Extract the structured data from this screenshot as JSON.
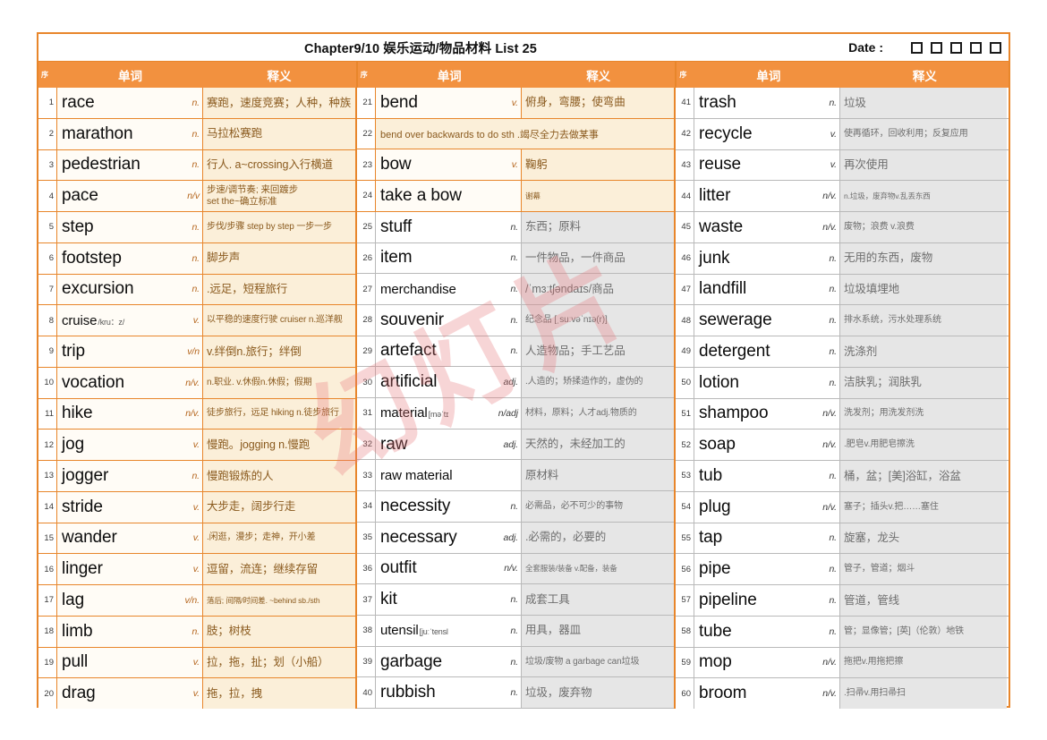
{
  "header": {
    "title": "Chapter9/10 娱乐运动/物品材料 List 25",
    "date_label": "Date :",
    "date_box_count": 5
  },
  "columns": {
    "index": "序",
    "word": "单词",
    "definition": "释义"
  },
  "colors": {
    "header_orange": "#F2913F",
    "border_orange": "#E8862B",
    "cream_def_bg": "#FBEFD9",
    "cream_def_text": "#8A5A1E",
    "gray_def_bg": "#E6E6E6",
    "gray_def_text": "#6E6E6E",
    "gray_border": "#B9B9B9",
    "watermark": "#E8767A"
  },
  "watermark": "幻灯片",
  "blocks": [
    {
      "theme": "orange",
      "rows": [
        {
          "n": "1",
          "word": "race",
          "pos": "n.",
          "def": "赛跑，速度竞赛；人种，种族"
        },
        {
          "n": "2",
          "word": "marathon",
          "pos": "n.",
          "def": "马拉松赛跑"
        },
        {
          "n": "3",
          "word": "pedestrian",
          "pos": "n.",
          "def": "行人. a~crossing入行横道"
        },
        {
          "n": "4",
          "word": "pace",
          "pos": "n/v",
          "def": "步速/调节奏; 来回踱步\nset the~确立标准",
          "def_style": "two"
        },
        {
          "n": "5",
          "word": "step",
          "pos": "n.",
          "def": "步伐/步骤 step by step 一步一步",
          "def_style": "small"
        },
        {
          "n": "6",
          "word": "footstep",
          "pos": "n.",
          "def": "脚步声"
        },
        {
          "n": "7",
          "word": "excursion",
          "pos": "n.",
          "def": ".远足，短程旅行"
        },
        {
          "n": "8",
          "word": "cruise",
          "phon": "/kru：z/",
          "pos": "v.",
          "def": "以平稳的速度行驶 cruiser n.巡洋舰",
          "def_style": "small",
          "word_style": "small"
        },
        {
          "n": "9",
          "word": "trip",
          "pos": "v/n",
          "def": "v.绊倒n.旅行；绊倒"
        },
        {
          "n": "10",
          "word": "vocation",
          "pos": "n/v.",
          "def": "n.职业. v.休假n.休假；假期",
          "def_style": "small"
        },
        {
          "n": "11",
          "word": "hike",
          "pos": "n/v.",
          "def": "徒步旅行，远足 hiking n.徒步旅行",
          "def_style": "small"
        },
        {
          "n": "12",
          "word": "jog",
          "pos": "v.",
          "def": "慢跑。jogging n.慢跑"
        },
        {
          "n": "13",
          "word": "jogger",
          "pos": "n.",
          "def": "慢跑锻炼的人"
        },
        {
          "n": "14",
          "word": "stride",
          "pos": "v.",
          "def": "大步走，阔步行走"
        },
        {
          "n": "15",
          "word": "wander",
          "pos": "v.",
          "def": ".闲逛，漫步；走神，开小差",
          "def_style": "small"
        },
        {
          "n": "16",
          "word": "linger",
          "pos": "v.",
          "def": "逗留，流连；继续存留"
        },
        {
          "n": "17",
          "word": "lag",
          "pos": "v/n.",
          "def": "落后; 间隔/时间差. ~behind sb./sth",
          "def_style": "tiny"
        },
        {
          "n": "18",
          "word": "limb",
          "pos": "n.",
          "def": "肢；树枝"
        },
        {
          "n": "19",
          "word": "pull",
          "pos": "v.",
          "def": "拉，拖，扯；划（小船）"
        },
        {
          "n": "20",
          "word": "drag",
          "pos": "v.",
          "def": "拖，拉，拽"
        }
      ]
    },
    {
      "theme": "mixed",
      "rows": [
        {
          "n": "21",
          "word": "bend",
          "pos": "v.",
          "def": "俯身，弯腰；使弯曲",
          "theme": "orange"
        },
        {
          "n": "22",
          "span": "bend over backwards to do sth .竭尽全力去做某事",
          "theme": "orange"
        },
        {
          "n": "23",
          "word": "bow",
          "pos": "v.",
          "def": "鞠躬",
          "theme": "orange"
        },
        {
          "n": "24",
          "word": "take a bow",
          "pos": "",
          "def": "谢幕",
          "def_style": "tiny",
          "theme": "orange"
        },
        {
          "n": "25",
          "word": "stuff",
          "pos": "n.",
          "def": "东西；原料",
          "theme": "gray"
        },
        {
          "n": "26",
          "word": "item",
          "pos": "n.",
          "def": "一件物品，一件商品",
          "theme": "gray"
        },
        {
          "n": "27",
          "word": "merchandise",
          "pos": "n.",
          "def": "/ˈmɜːtʃəndaɪs/商品",
          "theme": "gray",
          "word_style": "small"
        },
        {
          "n": "28",
          "word": "souvenir",
          "pos": "n.",
          "def": "纪念品 [ˌsuːvəˈnɪə(r)]",
          "def_style": "small",
          "theme": "gray"
        },
        {
          "n": "29",
          "word": "artefact",
          "pos": "n.",
          "def": "人造物品；手工艺品",
          "theme": "gray"
        },
        {
          "n": "30",
          "word": "artificial",
          "pos": "adj.",
          "def": ".人造的；矫揉造作的，虚伪的",
          "def_style": "small",
          "theme": "gray"
        },
        {
          "n": "31",
          "word": "material",
          "phon": "[məˈtɪ",
          "pos": "n/adj",
          "def": "材料，原料；人才adj.物质的",
          "def_style": "small",
          "theme": "gray",
          "word_style": "small"
        },
        {
          "n": "32",
          "word": "raw",
          "pos": "adj.",
          "def": "天然的，未经加工的",
          "theme": "gray"
        },
        {
          "n": "33",
          "word": "raw material",
          "pos": "",
          "def": "原材料",
          "theme": "gray",
          "word_style": "small"
        },
        {
          "n": "34",
          "word": "necessity",
          "pos": "n.",
          "def": "必需品，必不可少的事物",
          "def_style": "small",
          "theme": "gray"
        },
        {
          "n": "35",
          "word": "necessary",
          "pos": "adj.",
          "def": ".必需的，必要的",
          "theme": "gray"
        },
        {
          "n": "36",
          "word": "outfit",
          "pos": "n/v.",
          "def": "全套服装/装备 v.配备，装备",
          "def_style": "tiny",
          "theme": "gray"
        },
        {
          "n": "37",
          "word": "kit",
          "pos": "n.",
          "def": "成套工具",
          "theme": "gray"
        },
        {
          "n": "38",
          "word": "utensil",
          "phon": "[juːˈtensl",
          "pos": "n.",
          "def": "用具，器皿",
          "theme": "gray",
          "word_style": "small"
        },
        {
          "n": "39",
          "word": "garbage",
          "pos": "n.",
          "def": "垃圾/废物 a garbage can垃圾",
          "def_style": "small",
          "theme": "gray"
        },
        {
          "n": "40",
          "word": "rubbish",
          "pos": "n.",
          "def": "垃圾，废弃物",
          "theme": "gray"
        }
      ]
    },
    {
      "theme": "gray",
      "rows": [
        {
          "n": "41",
          "word": "trash",
          "pos": "n.",
          "def": "垃圾"
        },
        {
          "n": "42",
          "word": "recycle",
          "pos": "v.",
          "def": "使再循环，回收利用；反复应用",
          "def_style": "small"
        },
        {
          "n": "43",
          "word": "reuse",
          "pos": "v.",
          "def": "再次使用"
        },
        {
          "n": "44",
          "word": "litter",
          "pos": "n/v.",
          "def": "n.垃圾，废弃物v.乱丢东西",
          "def_style": "tiny"
        },
        {
          "n": "45",
          "word": "waste",
          "pos": "n/v.",
          "def": "废物；浪费 v.浪费",
          "def_style": "small"
        },
        {
          "n": "46",
          "word": "junk",
          "pos": "n.",
          "def": "无用的东西，废物"
        },
        {
          "n": "47",
          "word": "landfill",
          "pos": "n.",
          "def": "垃圾填埋地"
        },
        {
          "n": "48",
          "word": "sewerage",
          "pos": "n.",
          "def": "排水系统，污水处理系统",
          "def_style": "small"
        },
        {
          "n": "49",
          "word": "detergent",
          "pos": "n.",
          "def": "洗涤剂"
        },
        {
          "n": "50",
          "word": "lotion",
          "pos": "n.",
          "def": "洁肤乳；润肤乳"
        },
        {
          "n": "51",
          "word": "shampoo",
          "pos": "n/v.",
          "def": "洗发剂；用洗发剂洗",
          "def_style": "small"
        },
        {
          "n": "52",
          "word": "soap",
          "pos": "n/v.",
          "def": ".肥皂v.用肥皂擦洗",
          "def_style": "small"
        },
        {
          "n": "53",
          "word": "tub",
          "pos": "n.",
          "def": "桶，盆；[美]浴缸，浴盆"
        },
        {
          "n": "54",
          "word": "plug",
          "pos": "n/v.",
          "def": "塞子；插头v.把……塞住",
          "def_style": "small"
        },
        {
          "n": "55",
          "word": "tap",
          "pos": "n.",
          "def": "旋塞，龙头"
        },
        {
          "n": "56",
          "word": "pipe",
          "pos": "n.",
          "def": "管子，管道；烟斗",
          "def_style": "small"
        },
        {
          "n": "57",
          "word": "pipeline",
          "pos": "n.",
          "def": "管道，管线"
        },
        {
          "n": "58",
          "word": "tube",
          "pos": "n.",
          "def": "管；显像管；[英]（伦敦）地铁",
          "def_style": "small"
        },
        {
          "n": "59",
          "word": "mop",
          "pos": "n/v.",
          "def": "拖把v.用拖把擦",
          "def_style": "small"
        },
        {
          "n": "60",
          "word": "broom",
          "pos": "n/v.",
          "def": ".扫帚v.用扫帚扫",
          "def_style": "small"
        }
      ]
    }
  ]
}
